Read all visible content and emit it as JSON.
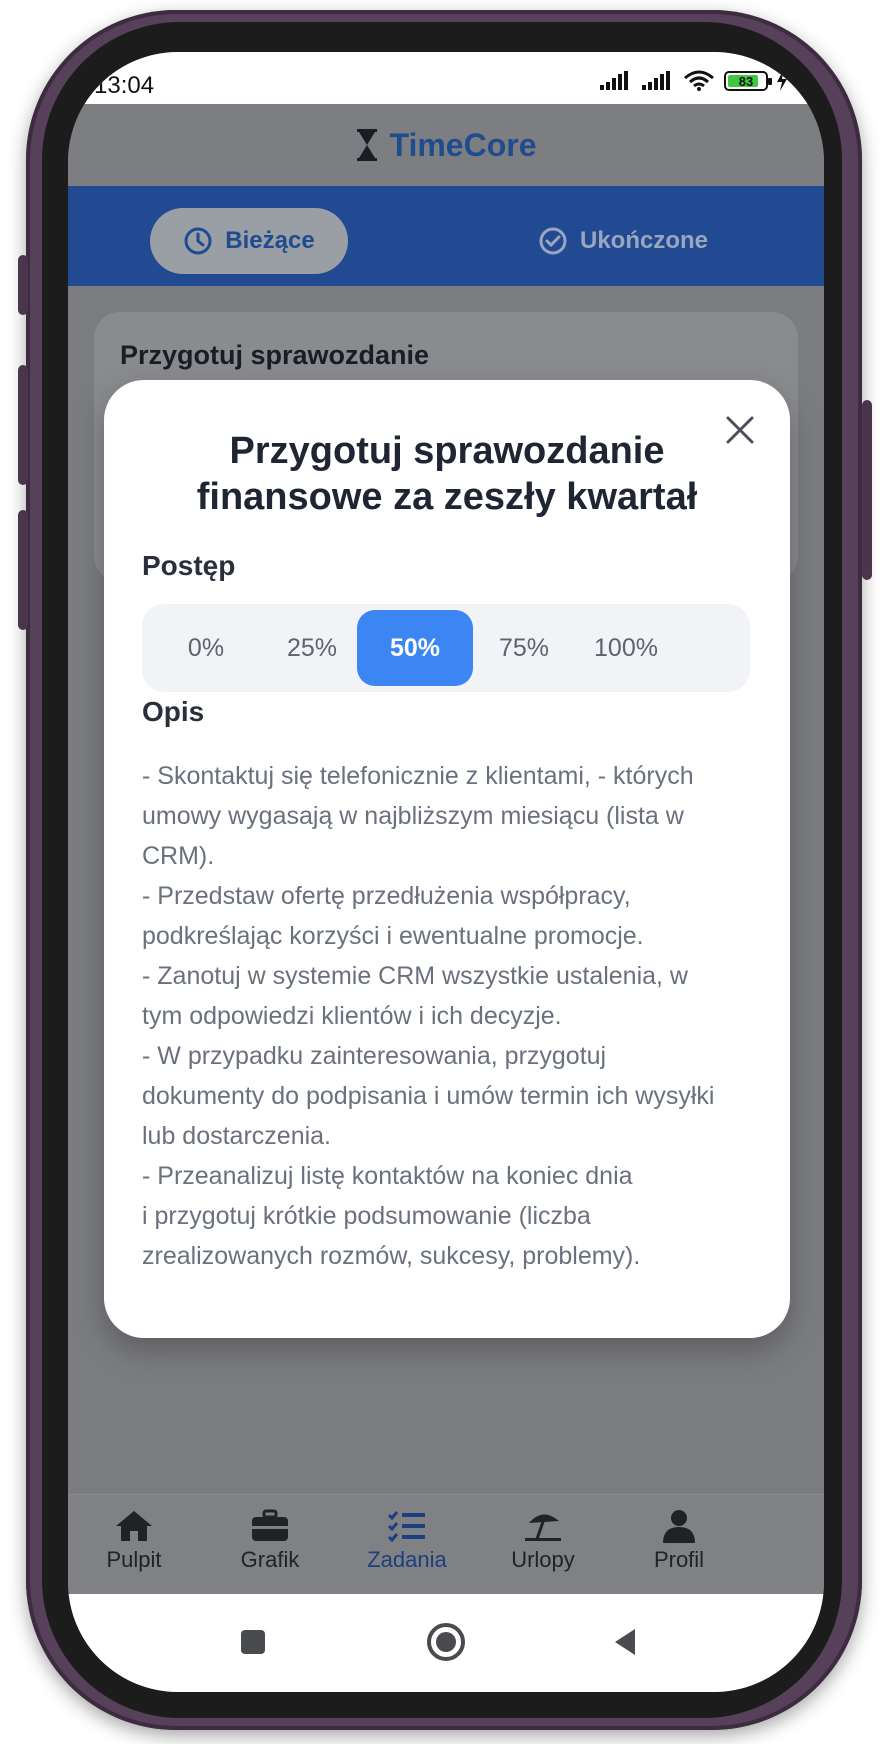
{
  "status_bar": {
    "time": "13:04",
    "battery": "83"
  },
  "app": {
    "brand": "TimeCore"
  },
  "tabs": [
    {
      "label": "Bieżące",
      "icon": "clock-icon",
      "active": true
    },
    {
      "label": "Ukończone",
      "icon": "check-circle-icon",
      "active": false
    }
  ],
  "background_card": {
    "title": "Przygotuj sprawozdanie"
  },
  "modal": {
    "title_line1": "Przygotuj sprawozdanie",
    "title_line2": "finansowe za zeszły kwartał",
    "progress_label": "Postęp",
    "progress_options": [
      "0%",
      "25%",
      "50%",
      "75%",
      "100%"
    ],
    "progress_selected": "50%",
    "progress_value": 0.5,
    "description_label": "Opis",
    "description_lines": [
      "- Skontaktuj się telefonicznie z klientami, - których",
      "umowy wygasają w najbliższym miesiącu (lista w",
      "CRM).",
      "- Przedstaw ofertę przedłużenia współpracy,",
      "podkreślając korzyści i ewentualne promocje.",
      "- Zanotuj w systemie CRM wszystkie ustalenia, w",
      "tym odpowiedzi klientów i ich decyzje.",
      "- W przypadku zainteresowania, przygotuj",
      "dokumenty do podpisania i umów termin ich wysyłki",
      "lub dostarczenia.",
      "- Przeanalizuj listę kontaktów na koniec dnia",
      "i przygotuj krótkie podsumowanie (liczba",
      "zrealizowanych rozmów, sukcesy, problemy)."
    ]
  },
  "bottom_nav": [
    {
      "label": "Pulpit",
      "icon": "home-icon"
    },
    {
      "label": "Grafik",
      "icon": "briefcase-icon"
    },
    {
      "label": "Zadania",
      "icon": "task-list-icon",
      "active": true
    },
    {
      "label": "Urlopy",
      "icon": "beach-umbrella-icon"
    },
    {
      "label": "Profil",
      "icon": "person-icon"
    }
  ],
  "colors": {
    "accent": "#3b86f2",
    "brand": "#214a93",
    "battery": "#41c740"
  }
}
